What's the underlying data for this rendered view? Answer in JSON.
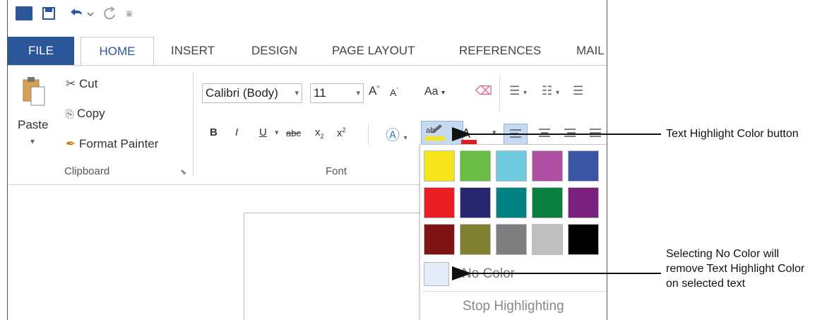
{
  "quick_access": {
    "logo_text": "W"
  },
  "tabs": [
    {
      "label": "FILE"
    },
    {
      "label": "HOME"
    },
    {
      "label": "INSERT"
    },
    {
      "label": "DESIGN"
    },
    {
      "label": "PAGE LAYOUT"
    },
    {
      "label": "REFERENCES"
    },
    {
      "label": "MAIL"
    }
  ],
  "clipboard": {
    "paste": "Paste",
    "cut": "Cut",
    "copy": "Copy",
    "format_painter": "Format Painter",
    "group_label": "Clipboard"
  },
  "font": {
    "family": "Calibri (Body)",
    "size": "11",
    "change_case": "Aa",
    "bold": "B",
    "italic": "I",
    "underline": "U",
    "strikethrough": "abc",
    "subscript": "x",
    "superscript": "x",
    "group_label": "Font"
  },
  "highlight_menu": {
    "colors": [
      "#f7e51b",
      "#69bd45",
      "#6fcadf",
      "#b04fa1",
      "#3b54a4",
      "#ea1d24",
      "#26276e",
      "#038080",
      "#0a8040",
      "#7a217d",
      "#7e1416",
      "#808033",
      "#7f7f7f",
      "#c0c0c0",
      "#000000"
    ],
    "no_color": "No Color",
    "stop": "Stop Highlighting"
  },
  "callouts": {
    "button": "Text Highlight Color button",
    "no_color_line1": "Selecting No Color will",
    "no_color_line2": "remove Text Highlight Color",
    "no_color_line3": "on selected text"
  }
}
